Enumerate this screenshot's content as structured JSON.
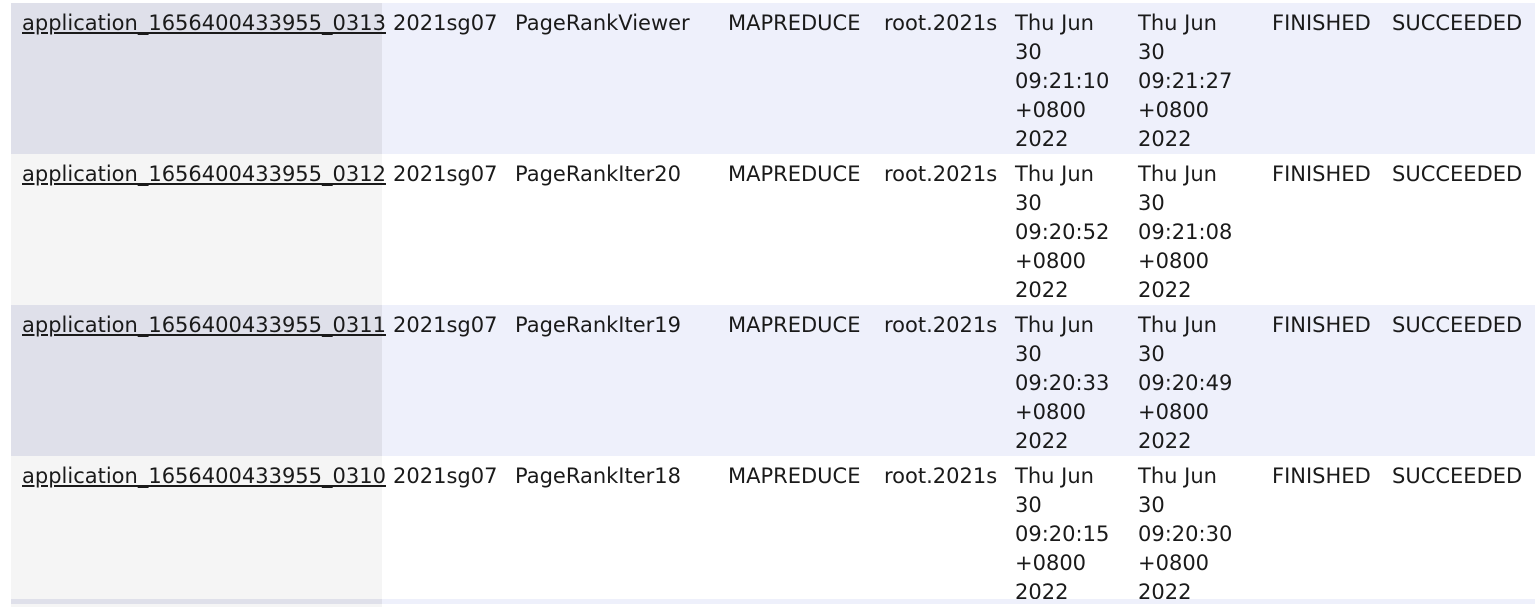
{
  "table": {
    "rows": [
      {
        "id": "application_1656400433955_0313",
        "user": "2021sg07",
        "name": "PageRankViewer",
        "type": "MAPREDUCE",
        "queue": "root.2021s",
        "start": [
          "Thu Jun",
          "30",
          "09:21:10",
          "+0800",
          "2022"
        ],
        "finish": [
          "Thu Jun",
          "30",
          "09:21:27",
          "+0800",
          "2022"
        ],
        "state": "FINISHED",
        "final_status": "SUCCEEDED"
      },
      {
        "id": "application_1656400433955_0312",
        "user": "2021sg07",
        "name": "PageRankIter20",
        "type": "MAPREDUCE",
        "queue": "root.2021s",
        "start": [
          "Thu Jun",
          "30",
          "09:20:52",
          "+0800",
          "2022"
        ],
        "finish": [
          "Thu Jun",
          "30",
          "09:21:08",
          "+0800",
          "2022"
        ],
        "state": "FINISHED",
        "final_status": "SUCCEEDED"
      },
      {
        "id": "application_1656400433955_0311",
        "user": "2021sg07",
        "name": "PageRankIter19",
        "type": "MAPREDUCE",
        "queue": "root.2021s",
        "start": [
          "Thu Jun",
          "30",
          "09:20:33",
          "+0800",
          "2022"
        ],
        "finish": [
          "Thu Jun",
          "30",
          "09:20:49",
          "+0800",
          "2022"
        ],
        "state": "FINISHED",
        "final_status": "SUCCEEDED"
      },
      {
        "id": "application_1656400433955_0310",
        "user": "2021sg07",
        "name": "PageRankIter18",
        "type": "MAPREDUCE",
        "queue": "root.2021s",
        "start": [
          "Thu Jun",
          "30",
          "09:20:15",
          "+0800",
          "2022"
        ],
        "finish": [
          "Thu Jun",
          "30",
          "09:20:30",
          "+0800",
          "2022"
        ],
        "state": "FINISHED",
        "final_status": "SUCCEEDED"
      }
    ]
  },
  "colors": {
    "odd_row": "#eef0fb",
    "even_row": "#ffffff",
    "odd_id_cell": "#dfe0ea",
    "even_id_cell": "#f5f5f5",
    "text": "#1a1a1a"
  }
}
